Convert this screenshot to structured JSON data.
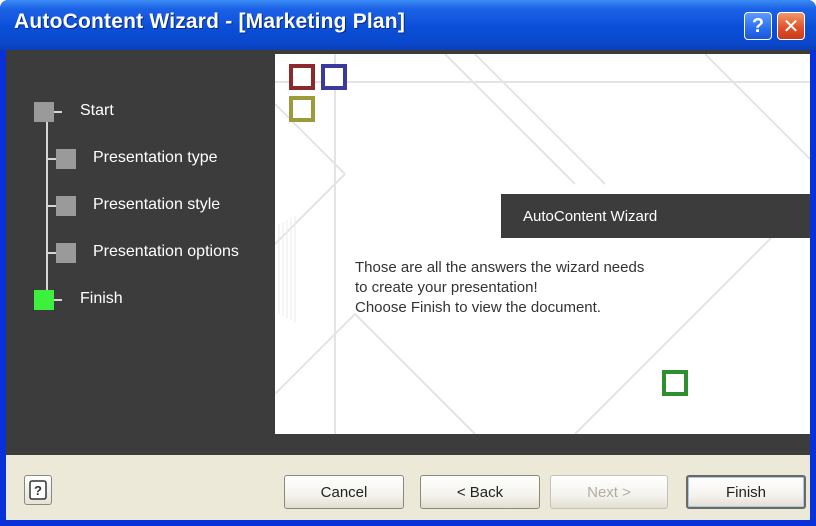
{
  "window": {
    "title": "AutoContent Wizard - [Marketing Plan]",
    "help_glyph": "?",
    "close_glyph": "✕"
  },
  "steps": [
    {
      "label": "Start",
      "state": "done"
    },
    {
      "label": "Presentation type",
      "state": "done"
    },
    {
      "label": "Presentation style",
      "state": "done"
    },
    {
      "label": "Presentation options",
      "state": "done"
    },
    {
      "label": "Finish",
      "state": "current"
    }
  ],
  "content": {
    "banner_title": "AutoContent Wizard",
    "message_lines": [
      "Those are all the answers the wizard needs",
      "to create your presentation!",
      "Choose Finish to view the document."
    ]
  },
  "buttons": {
    "help_label": "?",
    "cancel": "Cancel",
    "back": "< Back",
    "next": "Next >",
    "finish": "Finish"
  },
  "colors": {
    "title_bar": "#0a4fd8",
    "step_active": "#3df03d",
    "step_done": "#9a9a9a",
    "panel": "#3c3c3c",
    "sq_red": "#8b2a2a",
    "sq_blue": "#3a3a9c",
    "sq_olive": "#9c9a3a",
    "sq_green": "#2f8f2f"
  },
  "icons": {
    "help": "help-icon",
    "close": "close-icon",
    "step": "step-square-icon"
  }
}
